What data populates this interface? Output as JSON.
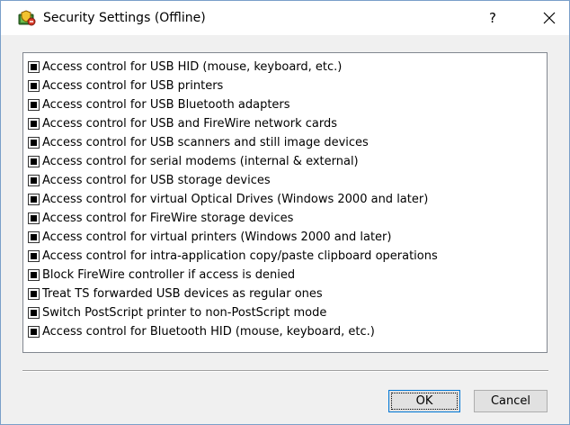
{
  "window": {
    "title": "Security Settings (Offline)",
    "help_glyph": "?",
    "close_glyph": "close-icon",
    "icon": "security-shield-icon"
  },
  "items": [
    {
      "label": "Access control for USB HID (mouse, keyboard, etc.)",
      "state": "indeterminate"
    },
    {
      "label": "Access control for USB printers",
      "state": "indeterminate"
    },
    {
      "label": "Access control for USB Bluetooth adapters",
      "state": "indeterminate"
    },
    {
      "label": "Access control for USB and FireWire network cards",
      "state": "indeterminate"
    },
    {
      "label": "Access control for USB scanners and still image devices",
      "state": "indeterminate"
    },
    {
      "label": "Access control for serial modems (internal & external)",
      "state": "indeterminate"
    },
    {
      "label": "Access control for USB storage devices",
      "state": "indeterminate"
    },
    {
      "label": "Access control for virtual Optical Drives (Windows 2000 and later)",
      "state": "indeterminate"
    },
    {
      "label": "Access control for FireWire storage devices",
      "state": "indeterminate"
    },
    {
      "label": "Access control for virtual printers (Windows 2000 and later)",
      "state": "indeterminate"
    },
    {
      "label": "Access control for intra-application copy/paste clipboard operations",
      "state": "indeterminate"
    },
    {
      "label": "Block FireWire controller if access is denied",
      "state": "indeterminate"
    },
    {
      "label": "Treat TS forwarded USB devices as regular ones",
      "state": "indeterminate"
    },
    {
      "label": "Switch PostScript printer to non-PostScript mode",
      "state": "indeterminate"
    },
    {
      "label": "Access control for Bluetooth HID (mouse, keyboard, etc.)",
      "state": "indeterminate"
    }
  ],
  "buttons": {
    "ok": "OK",
    "cancel": "Cancel"
  },
  "colors": {
    "accent": "#0078d7",
    "dialog_bg": "#f0f0f0",
    "window_border": "#7a9fc9"
  }
}
